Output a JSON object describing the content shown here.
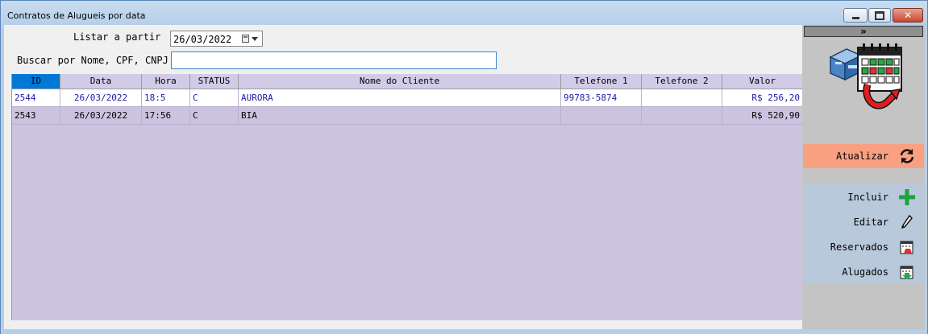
{
  "window": {
    "title": "Contratos de Alugueis por data"
  },
  "filters": {
    "list_from_label": "Listar a partir",
    "date_value": "26/03/2022",
    "search_label": "Buscar por Nome, CPF, CNPJ",
    "search_value": ""
  },
  "table": {
    "columns": [
      "ID",
      "Data",
      "Hora",
      "STATUS",
      "Nome do Cliente",
      "Telefone 1",
      "Telefone 2",
      "Valor"
    ],
    "rows": [
      [
        "2544",
        "26/03/2022",
        "18:5",
        "C",
        "AURORA",
        "99783-5874",
        "",
        "R$ 256,20"
      ],
      [
        "2543",
        "26/03/2022",
        "17:56",
        "C",
        "BIA",
        "",
        "",
        "R$ 520,90"
      ]
    ]
  },
  "sidebar": {
    "collapse_glyph": "»",
    "refresh_label": "Atualizar",
    "actions": [
      {
        "label": "Incluir",
        "icon": "plus-icon"
      },
      {
        "label": "Editar",
        "icon": "pencil-icon"
      },
      {
        "label": "Reservados",
        "icon": "calendar-reserved-icon"
      },
      {
        "label": "Alugados",
        "icon": "calendar-rented-icon"
      }
    ]
  },
  "colors": {
    "grid_background": "#ccc3e0",
    "selected_header": "#0078d7",
    "refresh_button": "#f9a081",
    "actions_panel": "#b9c9dc",
    "highlight_row_text": "#1a1aa8"
  }
}
